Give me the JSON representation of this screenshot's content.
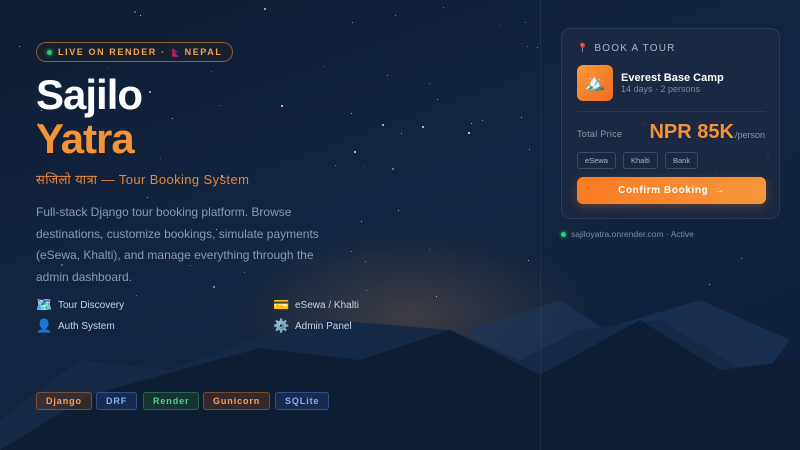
{
  "badge": {
    "live_text": "LIVE ON RENDER · ",
    "country": "NEPAL"
  },
  "hero": {
    "title_line1": "Sajilo",
    "title_line2": "Yatra",
    "subtitle": "सजिलो यात्रा — Tour Booking System",
    "description": "Full-stack Django tour booking platform. Browse destinations, customize bookings, simulate payments (eSewa, Khalti), and manage everything through the admin dashboard."
  },
  "features": [
    {
      "icon": "map-icon",
      "glyph": "🗺️",
      "label": "Tour Discovery"
    },
    {
      "icon": "card-icon",
      "glyph": "💳",
      "label": "eSewa / Khalti"
    },
    {
      "icon": "user-icon",
      "glyph": "👤",
      "label": "Auth System"
    },
    {
      "icon": "gear-icon",
      "glyph": "⚙️",
      "label": "Admin Panel"
    }
  ],
  "tech_stack": [
    "Django",
    "DRF",
    "Render",
    "Gunicorn",
    "SQLite"
  ],
  "booking_card": {
    "heading": "BOOK A TOUR",
    "tour": {
      "name": "Everest Base Camp",
      "meta": "14 days · 2 persons",
      "thumb_glyph": "🏔️"
    },
    "price_label": "Total Price",
    "price_value": "NPR 85K",
    "price_unit": "/person",
    "payment_methods": [
      "eSewa",
      "Khalti",
      "Bank"
    ],
    "confirm_label": "Confirm Booking",
    "confirm_arrow": "→"
  },
  "status": {
    "text": "sajiloyatra.onrender.com · Active"
  },
  "colors": {
    "accent": "#f79236",
    "live": "#2ecc71",
    "background": "#132540"
  }
}
